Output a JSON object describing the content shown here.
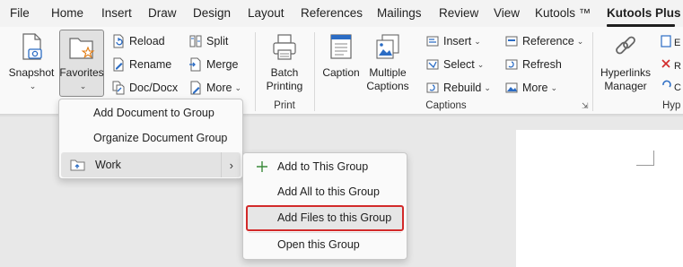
{
  "tabs": [
    "File",
    "Home",
    "Insert",
    "Draw",
    "Design",
    "Layout",
    "References",
    "Mailings",
    "Review",
    "View",
    "Kutools ™",
    "Kutools Plus"
  ],
  "ribbon": {
    "snapshot": "Snapshot",
    "favorites": "Favorites",
    "reload": "Reload",
    "rename": "Rename",
    "doc_docx": "Doc/Docx",
    "split": "Split",
    "merge": "Merge",
    "more1": "More",
    "batch_line1": "Batch",
    "batch_line2": "Printing",
    "print_group": "Print",
    "caption": "Caption",
    "multiple_line1": "Multiple",
    "multiple_line2": "Captions",
    "insert": "Insert",
    "select": "Select",
    "rebuild": "Rebuild",
    "reference": "Reference",
    "refresh": "Refresh",
    "more2": "More",
    "captions_group": "Captions",
    "hyperlinks_line1": "Hyperlinks",
    "hyperlinks_line2": "Manager",
    "hyp_group_partial": "Hyp"
  },
  "favorites_menu": {
    "add_document": "Add Document to Group",
    "organize": "Organize Document Group",
    "work": "Work"
  },
  "work_submenu": {
    "add_to_group": "Add to This Group",
    "add_all": "Add All to this Group",
    "add_files": "Add Files to this Group",
    "open_group": "Open this Group"
  },
  "colors": {
    "highlight_border": "#d22a2a",
    "plus_icon": "#3a8a3a",
    "accent_blue": "#2b6cc4"
  }
}
